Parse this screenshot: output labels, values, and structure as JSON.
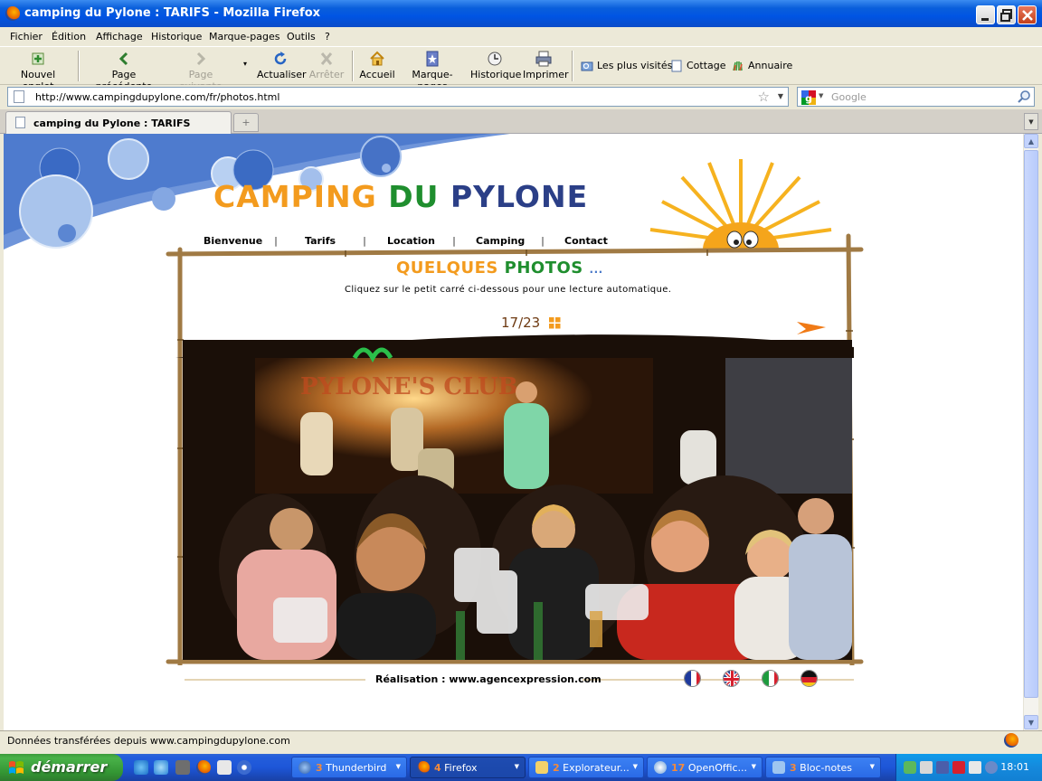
{
  "window": {
    "title": "camping du Pylone : TARIFS - Mozilla Firefox"
  },
  "menu": [
    "Fichier",
    "Édition",
    "Affichage",
    "Historique",
    "Marque-pages",
    "Outils",
    "?"
  ],
  "toolbar": {
    "new_tab": "Nouvel onglet",
    "back": "Page précédente",
    "forward": "Page suivante",
    "reload": "Actualiser",
    "stop": "Arrêter",
    "home": "Accueil",
    "bookmarks": "Marque-pages",
    "history": "Historique",
    "print": "Imprimer"
  },
  "bookmarks_bar": [
    "Les plus visités",
    "Cottage",
    "Annuaire"
  ],
  "location": {
    "url": "http://www.campingdupylone.com/fr/photos.html",
    "search_placeholder": "Google"
  },
  "tabs": [
    {
      "label": "camping du Pylone : TARIFS"
    }
  ],
  "site": {
    "logo_words": [
      "CAMPING",
      "DU",
      "PYLONE"
    ],
    "nav": [
      "Bienvenue",
      "Tarifs",
      "Location",
      "Camping",
      "Contact"
    ],
    "nav_separator": "|",
    "section_title": {
      "a": "QUELQUES",
      "b": "PHOTOS",
      "c": "..."
    },
    "instruction": "Cliquez sur le petit carré ci-dessous pour une lecture automatique.",
    "counter": "17/23",
    "credit": "Réalisation : www.agencexpression.com",
    "flags": [
      "fr",
      "en",
      "it",
      "de"
    ]
  },
  "statusbar": {
    "text": "Données transférées depuis www.campingdupylone.com"
  },
  "taskbar": {
    "start_label": "démarrer",
    "tasks": [
      {
        "count": "3",
        "label": "Thunderbird"
      },
      {
        "count": "4",
        "label": "Firefox"
      },
      {
        "count": "2",
        "label": "Explorateur..."
      },
      {
        "count": "17",
        "label": "OpenOffic..."
      },
      {
        "count": "3",
        "label": "Bloc-notes"
      }
    ],
    "clock": "18:01"
  },
  "colors": {
    "logo_orange": "#F39B1E",
    "logo_green": "#1F8E2E",
    "logo_blue": "#2B3F87",
    "xp_blue": "#245EDC",
    "start_green": "#3C9A3C"
  }
}
